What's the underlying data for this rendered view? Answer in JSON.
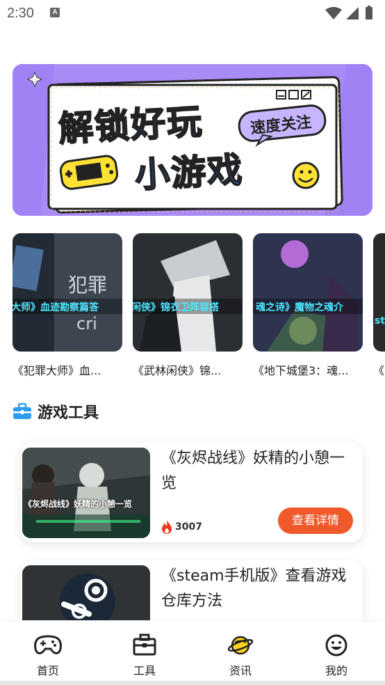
{
  "status_bar": {
    "time": "2:30",
    "notification_icon": "A"
  },
  "banner": {
    "headline_line1": "解锁好玩",
    "headline_line2": "小游戏",
    "tag": "速度关注",
    "colors": {
      "background": "#a98bf6",
      "card": "#ffffff",
      "blue": "#2f7fff",
      "yellow": "#ffe234"
    }
  },
  "games": [
    {
      "title": "《犯罪大师》血...",
      "overlay": "大师》血迹勘察篇答"
    },
    {
      "title": "《武林闲侠》锦...",
      "overlay": "闲侠》锦衣卫阵容搭"
    },
    {
      "title": "《地下城堡3：魂...",
      "overlay": "魂之诗》魔物之魂介"
    },
    {
      "title": "《",
      "overlay": "st"
    }
  ],
  "section": {
    "title": "游戏工具",
    "icon": "toolbox-icon"
  },
  "tools": [
    {
      "title": "《灰烬战线》妖精的小憩一览",
      "thumb_caption": "《灰烬战线》妖精的小憩一览",
      "hot": "3007",
      "button": "查看详情"
    },
    {
      "title": "《steam手机版》查看游戏仓库方法"
    }
  ],
  "tabs": [
    {
      "label": "首页",
      "icon": "gamepad-icon"
    },
    {
      "label": "工具",
      "icon": "toolbox-icon"
    },
    {
      "label": "资讯",
      "icon": "planet-icon"
    },
    {
      "label": "我的",
      "icon": "smiley-icon"
    }
  ],
  "accent": "#f05a2a"
}
